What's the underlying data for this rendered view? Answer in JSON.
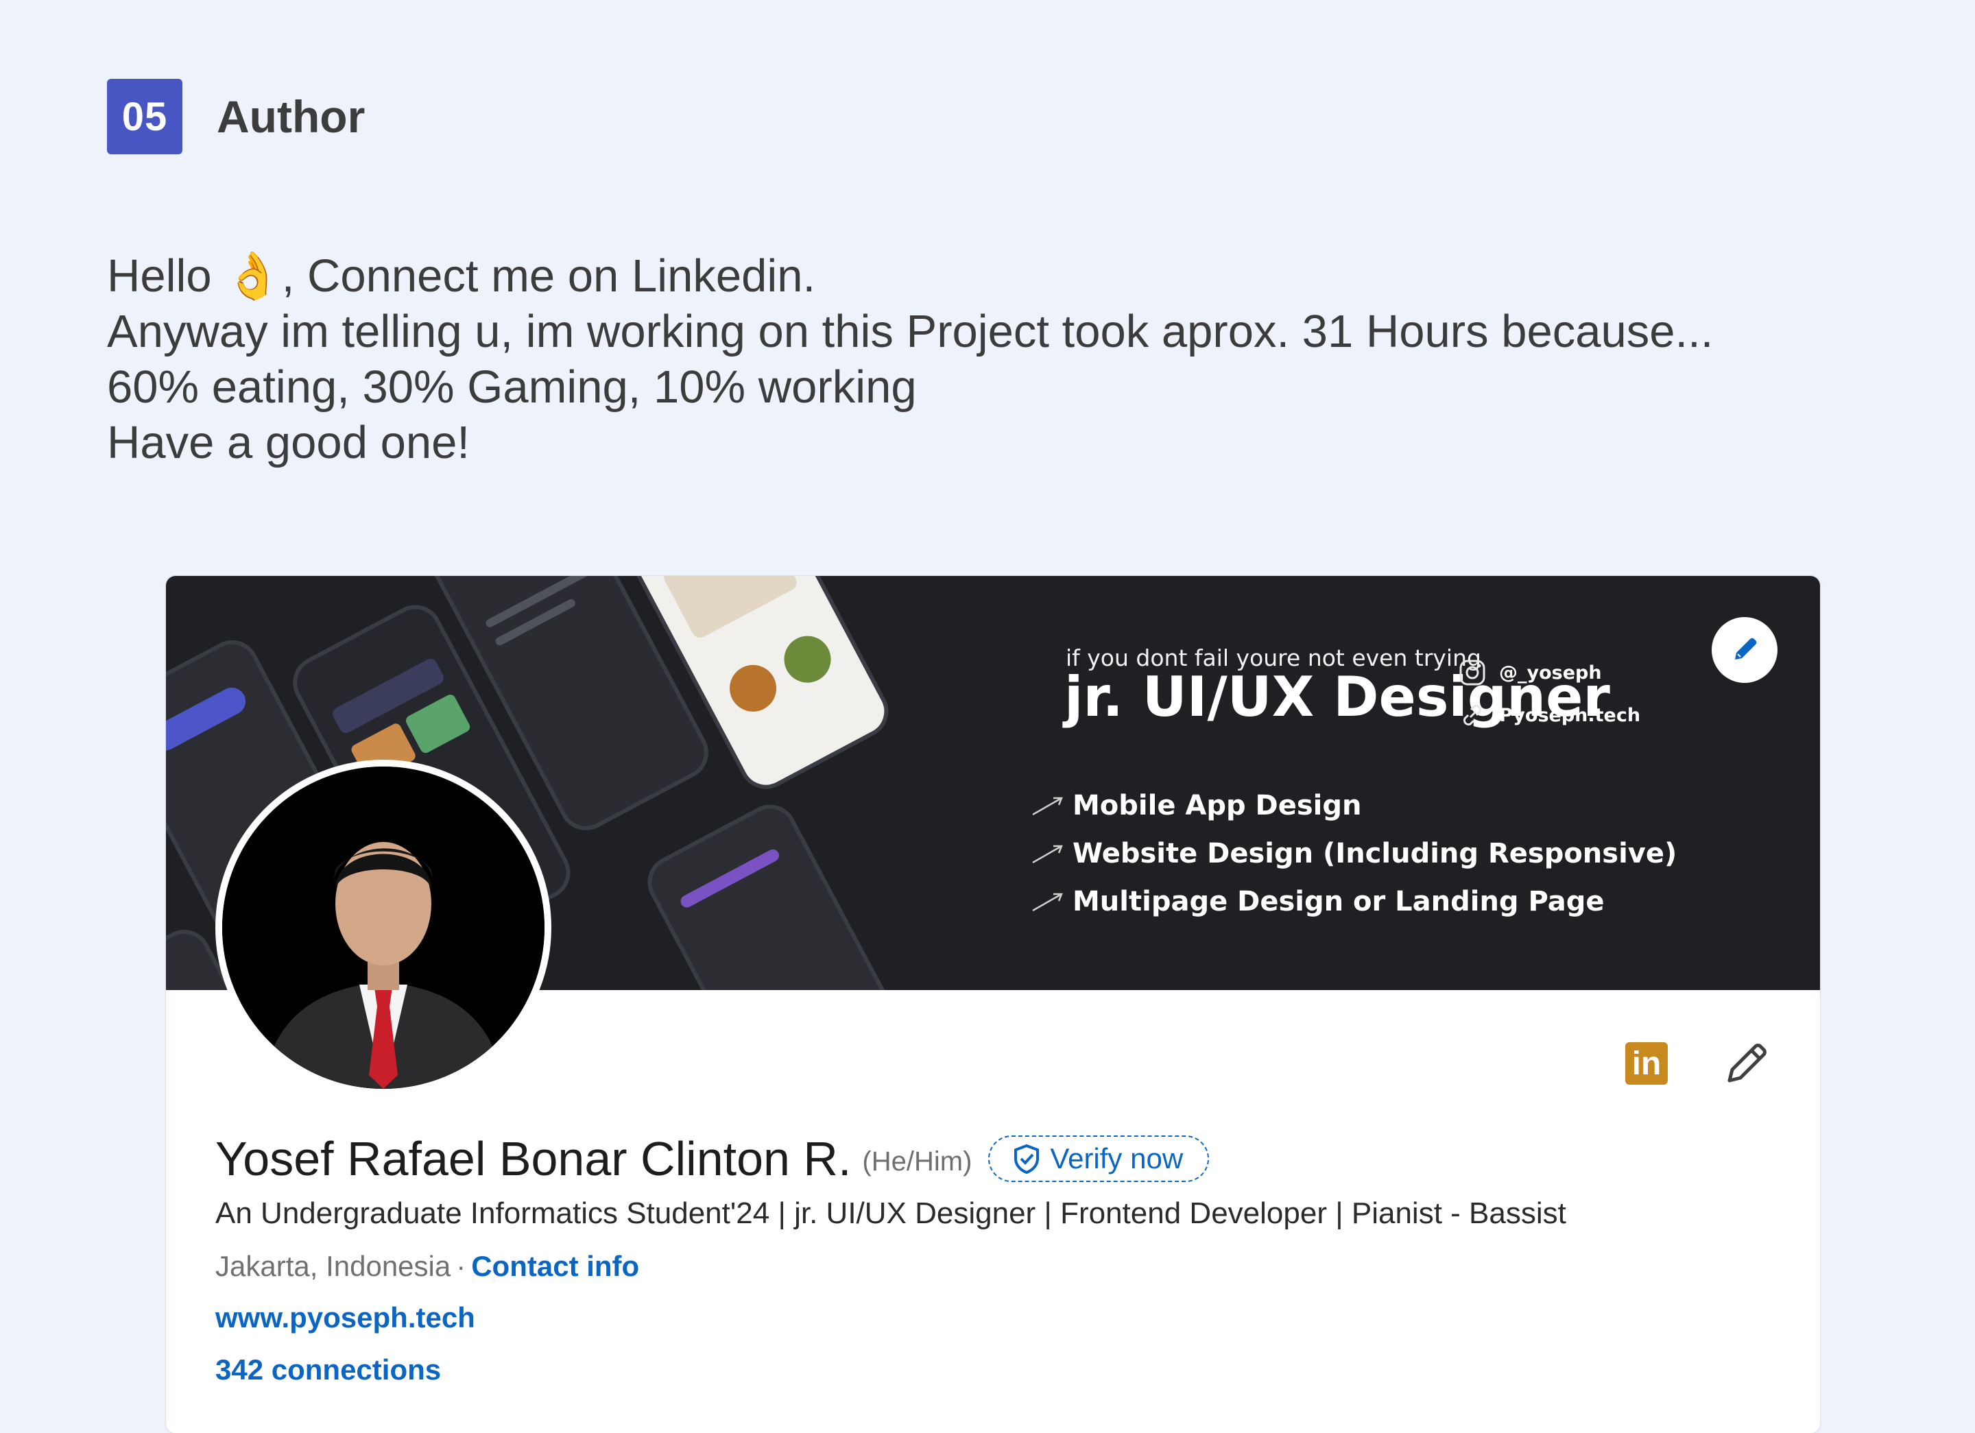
{
  "section": {
    "number": "05",
    "title": "Author"
  },
  "intro": {
    "lines": [
      "Hello 👌, Connect me on Linkedin.",
      "Anyway im telling u, im working on this Project took aprox. 31 Hours because...",
      "60% eating, 30% Gaming, 10% working",
      "Have a good one!"
    ]
  },
  "profile": {
    "banner": {
      "tagline": "if you dont fail youre not even trying",
      "headline": "jr. UI/UX Designer",
      "services": [
        "Mobile App Design",
        "Website Design (Including Responsive)",
        "Multipage Design or Landing Page"
      ],
      "socials": [
        {
          "icon": "instagram-icon",
          "label": "@_yoseph"
        },
        {
          "icon": "link-icon",
          "label": "Pyoseph.tech"
        }
      ]
    },
    "name": "Yosef Rafael Bonar Clinton R.",
    "pronouns": "(He/Him)",
    "verify_label": "Verify now",
    "headline": "An Undergraduate Informatics Student'24 | jr. UI/UX Designer | Frontend Developer | Pianist - Bassist",
    "location": "Jakarta, Indonesia",
    "location_separator": "·",
    "contact_label": "Contact info",
    "website": "www.pyoseph.tech",
    "connections": "342 connections",
    "icons": {
      "banner_edit": "edit-pencil-icon",
      "linkedin": "linkedin-icon",
      "edit_profile": "pencil-icon",
      "verify": "shield-check-icon"
    }
  },
  "colors": {
    "background": "#eef2fb",
    "badge": "#4756c2",
    "link_blue": "#0a66c2",
    "banner_dark": "#1f2023",
    "linkedin_logo": "#c88a1e"
  }
}
